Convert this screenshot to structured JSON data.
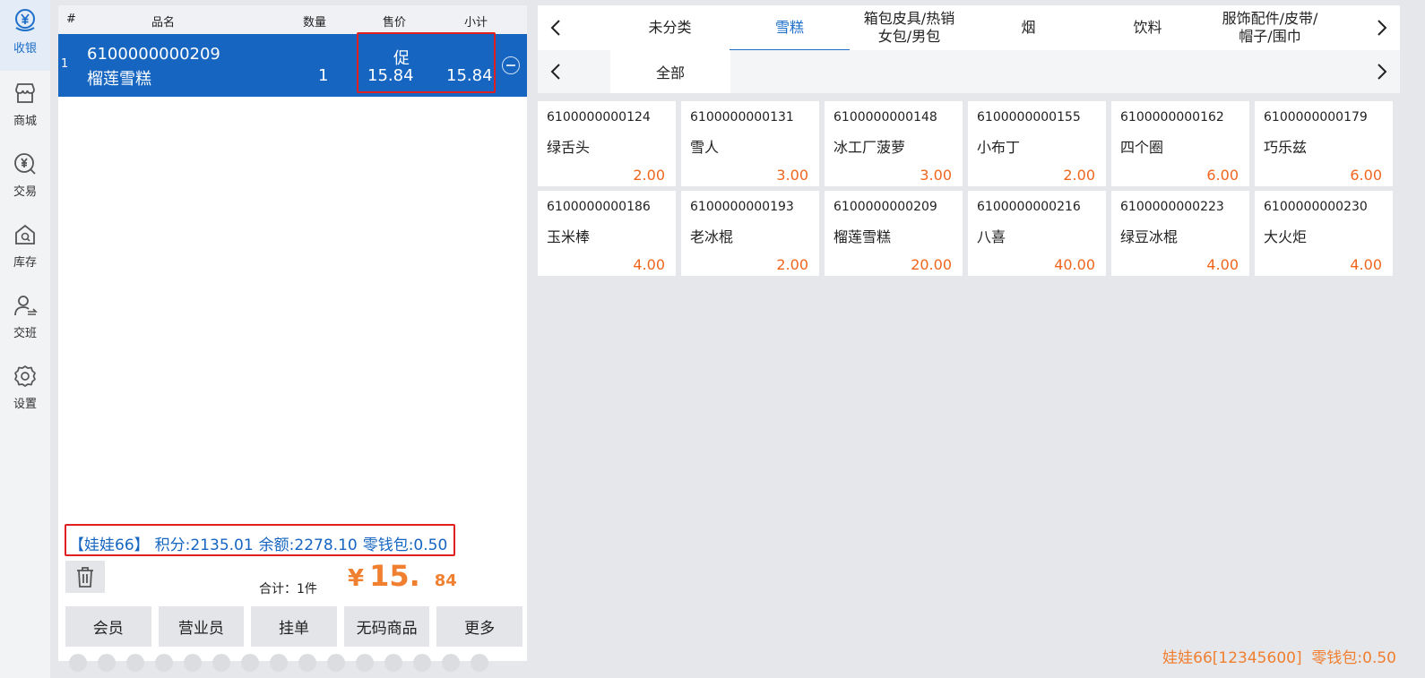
{
  "nav": [
    {
      "label": "收银",
      "icon": "yen-cash-icon",
      "active": true
    },
    {
      "label": "商城",
      "icon": "store-icon",
      "active": false
    },
    {
      "label": "交易",
      "icon": "yen-search-icon",
      "active": false
    },
    {
      "label": "库存",
      "icon": "warehouse-icon",
      "active": false
    },
    {
      "label": "交班",
      "icon": "user-switch-icon",
      "active": false
    },
    {
      "label": "设置",
      "icon": "gear-icon",
      "active": false
    }
  ],
  "cart": {
    "headers": {
      "index": "#",
      "name": "品名",
      "qty": "数量",
      "price": "售价",
      "subtotal": "小计"
    },
    "rows": [
      {
        "index": "1",
        "code": "6100000000209",
        "name": "榴莲雪糕",
        "qty": "1",
        "promo": "促",
        "price": "15.84",
        "subtotal": "15.84"
      }
    ]
  },
  "member": {
    "name": "【娃娃66】",
    "points": "积分:2135.01",
    "balance": "余额:2278.10",
    "wallet": "零钱包:0.50"
  },
  "totals": {
    "count_label": "合计：1件",
    "currency": "¥",
    "integer": "15.",
    "decimal": "84"
  },
  "actions": [
    "会员",
    "营业员",
    "挂单",
    "无码商品",
    "更多"
  ],
  "categories": {
    "tabs": [
      "未分类",
      "雪糕",
      "箱包皮具/热销女包/男包",
      "烟",
      "饮料",
      "服饰配件/皮带/帽子/围巾"
    ],
    "active_index": 1,
    "subtabs": [
      "全部"
    ]
  },
  "products": [
    {
      "code": "6100000000124",
      "name": "绿舌头",
      "price": "2.00"
    },
    {
      "code": "6100000000131",
      "name": "雪人",
      "price": "3.00"
    },
    {
      "code": "6100000000148",
      "name": "冰工厂菠萝",
      "price": "3.00"
    },
    {
      "code": "6100000000155",
      "name": "小布丁",
      "price": "2.00"
    },
    {
      "code": "6100000000162",
      "name": "四个圈",
      "price": "6.00"
    },
    {
      "code": "6100000000179",
      "name": "巧乐兹",
      "price": "6.00"
    },
    {
      "code": "6100000000186",
      "name": "玉米棒",
      "price": "4.00"
    },
    {
      "code": "6100000000193",
      "name": "老冰棍",
      "price": "2.00"
    },
    {
      "code": "6100000000209",
      "name": "榴莲雪糕",
      "price": "20.00"
    },
    {
      "code": "6100000000216",
      "name": "八喜",
      "price": "40.00"
    },
    {
      "code": "6100000000223",
      "name": "绿豆冰棍",
      "price": "4.00"
    },
    {
      "code": "6100000000230",
      "name": "大火炬",
      "price": "4.00"
    }
  ],
  "footer": {
    "user": "娃娃66[12345600]",
    "wallet": "零钱包:0.50"
  },
  "colors": {
    "accent": "#1665c1",
    "price": "#f0651e",
    "total": "#f07f2f",
    "highlight_border": "#e02020"
  }
}
